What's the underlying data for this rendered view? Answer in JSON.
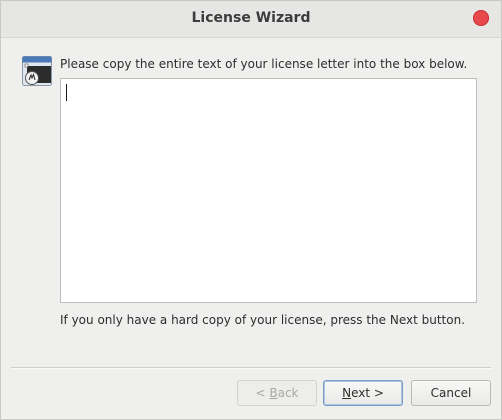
{
  "window": {
    "title": "License Wizard"
  },
  "content": {
    "instruction": "Please copy the entire text of your license letter into the box below.",
    "license_text": "",
    "hint": "If you only have a hard copy of your license, press the Next button."
  },
  "buttons": {
    "back_prefix": "< ",
    "back_key": "B",
    "back_rest": "ack",
    "back_enabled": false,
    "next_key": "N",
    "next_rest": "ext >",
    "cancel_label": "Cancel"
  },
  "icons": {
    "close": "close-icon",
    "wizard": "license-wizard-icon"
  },
  "colors": {
    "close_button": "#e8474c",
    "default_button_border": "#7a9cc6"
  }
}
